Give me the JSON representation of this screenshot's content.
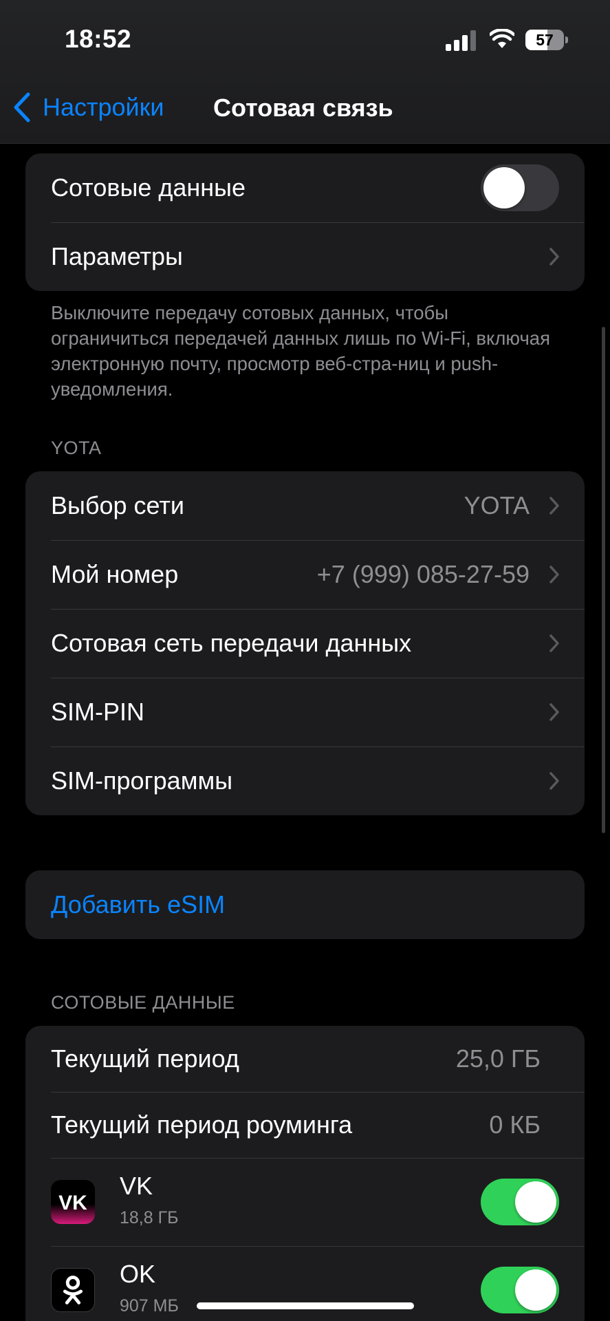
{
  "status_bar": {
    "time": "18:52",
    "battery": "57",
    "battery_level": 0.57
  },
  "nav": {
    "back_label": "Настройки",
    "title": "Сотовая связь"
  },
  "top_group": {
    "cellular_data_label": "Сотовые данные",
    "cellular_data_on": false,
    "options_label": "Параметры"
  },
  "note": "Выключите передачу сотовых данных, чтобы ограничиться передачей данных лишь по Wi-Fi, включая электронную почту, просмотр веб-стра-ниц и push-уведомления.",
  "carrier": {
    "header": "YOTA",
    "rows": [
      {
        "label": "Выбор сети",
        "value": "YOTA"
      },
      {
        "label": "Мой номер",
        "value": "+7 (999) 085-27-59"
      },
      {
        "label": "Сотовая сеть передачи данных",
        "value": ""
      },
      {
        "label": "SIM-PIN",
        "value": ""
      },
      {
        "label": "SIM-программы",
        "value": ""
      }
    ]
  },
  "esim": {
    "add_label": "Добавить eSIM"
  },
  "usage": {
    "header": "СОТОВЫЕ ДАННЫЕ",
    "current_period_label": "Текущий период",
    "current_period_value": "25,0 ГБ",
    "roaming_label": "Текущий период роуминга",
    "roaming_value": "0 КБ",
    "apps": [
      {
        "name": "VK",
        "size": "18,8 ГБ",
        "icon": "vk-icon",
        "enabled": true
      },
      {
        "name": "OK",
        "size": "907 МБ",
        "icon": "ok-icon",
        "enabled": true
      }
    ]
  },
  "colors": {
    "accent": "#0a84ff",
    "toggle_on": "#30d158",
    "cell_bg": "#1c1c1e",
    "secondary_text": "#8e8e93"
  }
}
